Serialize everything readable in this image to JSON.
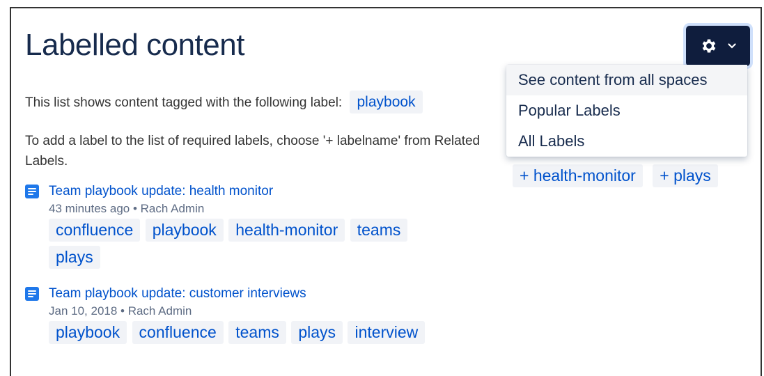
{
  "page": {
    "title": "Labelled content",
    "intro_text": "This list shows content tagged with the following label:",
    "current_label": "playbook",
    "help_text": "To add a label to the list of required labels, choose '+ labelname' from Related Labels."
  },
  "menu": {
    "button_icon": "gear-icon",
    "items": [
      "See content from all spaces",
      "Popular Labels",
      "All Labels"
    ]
  },
  "related_labels": [
    "+ health-monitor",
    "+ plays"
  ],
  "results": [
    {
      "title": "Team playbook update: health monitor",
      "meta": "43 minutes ago • Rach Admin",
      "labels": [
        "confluence",
        "playbook",
        "health-monitor",
        "teams",
        "plays"
      ]
    },
    {
      "title": "Team playbook update: customer interviews",
      "meta": "Jan 10, 2018 • Rach Admin",
      "labels": [
        "playbook",
        "confluence",
        "teams",
        "plays",
        "interview"
      ]
    }
  ],
  "colors": {
    "link": "#0052cc",
    "label_bg": "#f1f3f7",
    "button_bg": "#0f1d3d",
    "page_icon": "#1f78ea"
  }
}
